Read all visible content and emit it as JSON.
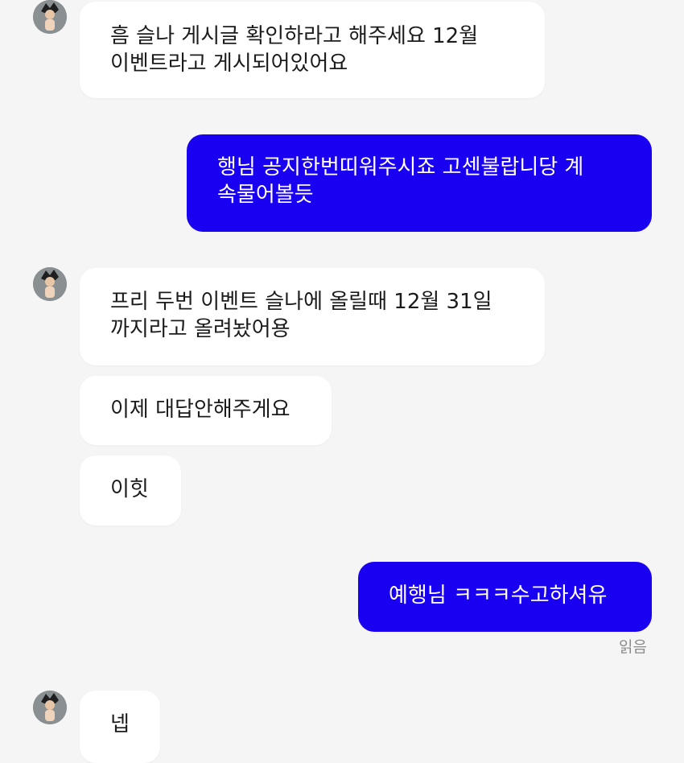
{
  "colors": {
    "background": "#f5f5f6",
    "incoming_bubble": "#ffffff",
    "outgoing_bubble": "#1a00f0",
    "read_receipt": "#8b8b8b"
  },
  "messages": [
    {
      "direction": "incoming",
      "text": "흠 슬나 게시글 확인하라고 해주세요 12월\n이벤트라고 게시되어있어요"
    },
    {
      "direction": "outgoing",
      "text": "행님 공지한번띠워주시죠 고센불랍니당 계\n속물어볼듯"
    },
    {
      "direction": "incoming",
      "text": "프리 두번 이벤트 슬나에 올릴때 12월 31일\n까지라고 올려놨어용"
    },
    {
      "direction": "incoming",
      "text": "이제 대답안해주게요"
    },
    {
      "direction": "incoming",
      "text": "이힛"
    },
    {
      "direction": "outgoing",
      "text": "예행님 ㅋㅋㅋ수고하셔유"
    },
    {
      "direction": "incoming",
      "text": "넵"
    }
  ],
  "read_receipt": "읽음",
  "avatar_icon": "profile-avatar-icon"
}
